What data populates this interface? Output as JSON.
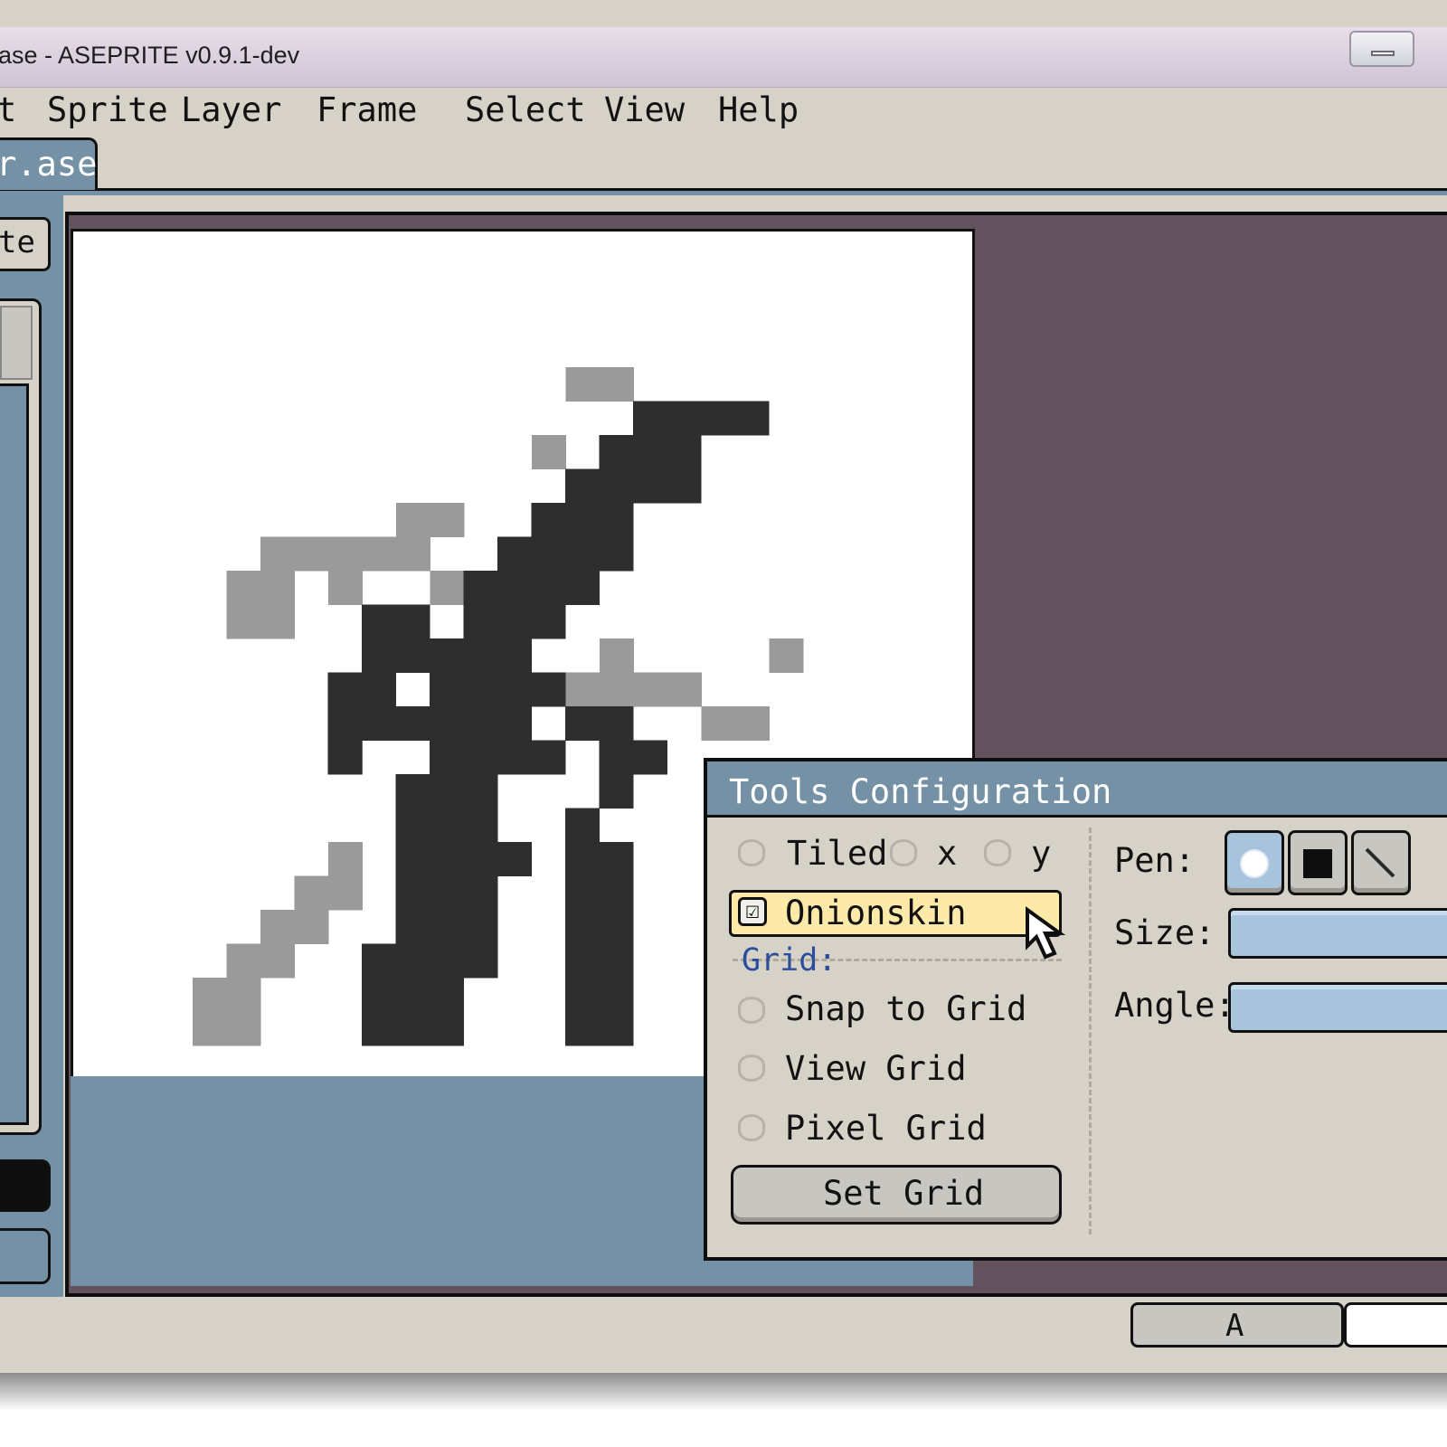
{
  "window": {
    "title": "ase - ASEPRITE v0.9.1-dev"
  },
  "menu": {
    "items": [
      {
        "label": "t",
        "name": "menu-edit"
      },
      {
        "label": "Sprite",
        "name": "menu-sprite"
      },
      {
        "label": "Layer",
        "name": "menu-layer"
      },
      {
        "label": "Frame",
        "name": "menu-frame"
      },
      {
        "label": "Select",
        "name": "menu-select"
      },
      {
        "label": "View",
        "name": "menu-view"
      },
      {
        "label": "Help",
        "name": "menu-help"
      }
    ]
  },
  "tabs": {
    "active_file": "r.ase"
  },
  "left_panel": {
    "palette_button": "te"
  },
  "status": {
    "layer_button": "A"
  },
  "tools_config": {
    "title": "Tools Configuration",
    "tiled": {
      "label": "Tiled",
      "checked": false
    },
    "tiled_x": {
      "label": "x",
      "checked": false
    },
    "tiled_y": {
      "label": "y",
      "checked": false
    },
    "onionskin": {
      "label": "Onionskin",
      "checked": true,
      "mark": "☑"
    },
    "grid_section": "Grid:",
    "snap_to_grid": {
      "label": "Snap to Grid",
      "checked": false
    },
    "view_grid": {
      "label": "View Grid",
      "checked": false
    },
    "pixel_grid": {
      "label": "Pixel Grid",
      "checked": false
    },
    "set_grid_button": "Set Grid",
    "pen_label": "Pen:",
    "size_label": "Size:",
    "angle_label": "Angle:",
    "pen_shapes": [
      "round-pen-icon",
      "square-pen-icon",
      "line-pen-icon"
    ]
  },
  "colors": {
    "face": "#d6d2c8",
    "accent": "#7491a6",
    "editor_bg": "#62535e",
    "pixel_dark": "#2e2e2e",
    "pixel_light": "#9a9a9a",
    "highlight": "#fde9a8"
  }
}
